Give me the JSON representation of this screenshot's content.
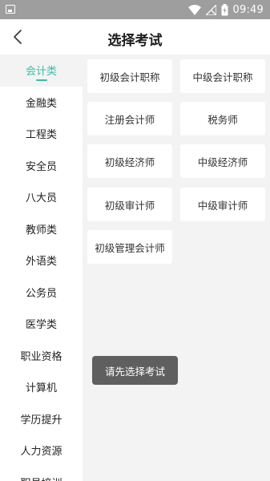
{
  "status_bar": {
    "time": "09:49",
    "icons": [
      "image-icon",
      "wifi-icon",
      "no-signal-icon",
      "battery-icon"
    ]
  },
  "header": {
    "title": "选择考试",
    "back_icon": "chevron-left-icon"
  },
  "colors": {
    "accent": "#35bfa6",
    "status_bar": "#9e9e9e",
    "content_bg": "#f3f3f4",
    "toast_bg": "#5f5f5f"
  },
  "sidebar": {
    "items": [
      {
        "label": "会计类",
        "active": true
      },
      {
        "label": "金融类"
      },
      {
        "label": "工程类"
      },
      {
        "label": "安全员"
      },
      {
        "label": "八大员"
      },
      {
        "label": "教师类"
      },
      {
        "label": "外语类"
      },
      {
        "label": "公务员"
      },
      {
        "label": "医学类"
      },
      {
        "label": "职业资格"
      },
      {
        "label": "计算机"
      },
      {
        "label": "学历提升"
      },
      {
        "label": "人力资源"
      },
      {
        "label": "职员培训"
      }
    ]
  },
  "exams": [
    {
      "label": "初级会计职称"
    },
    {
      "label": "中级会计职称"
    },
    {
      "label": "注册会计师"
    },
    {
      "label": "税务师"
    },
    {
      "label": "初级经济师"
    },
    {
      "label": "中级经济师"
    },
    {
      "label": "初级审计师"
    },
    {
      "label": "中级审计师"
    },
    {
      "label": "初级管理会计师"
    }
  ],
  "toast": {
    "message": "请先选择考试"
  }
}
